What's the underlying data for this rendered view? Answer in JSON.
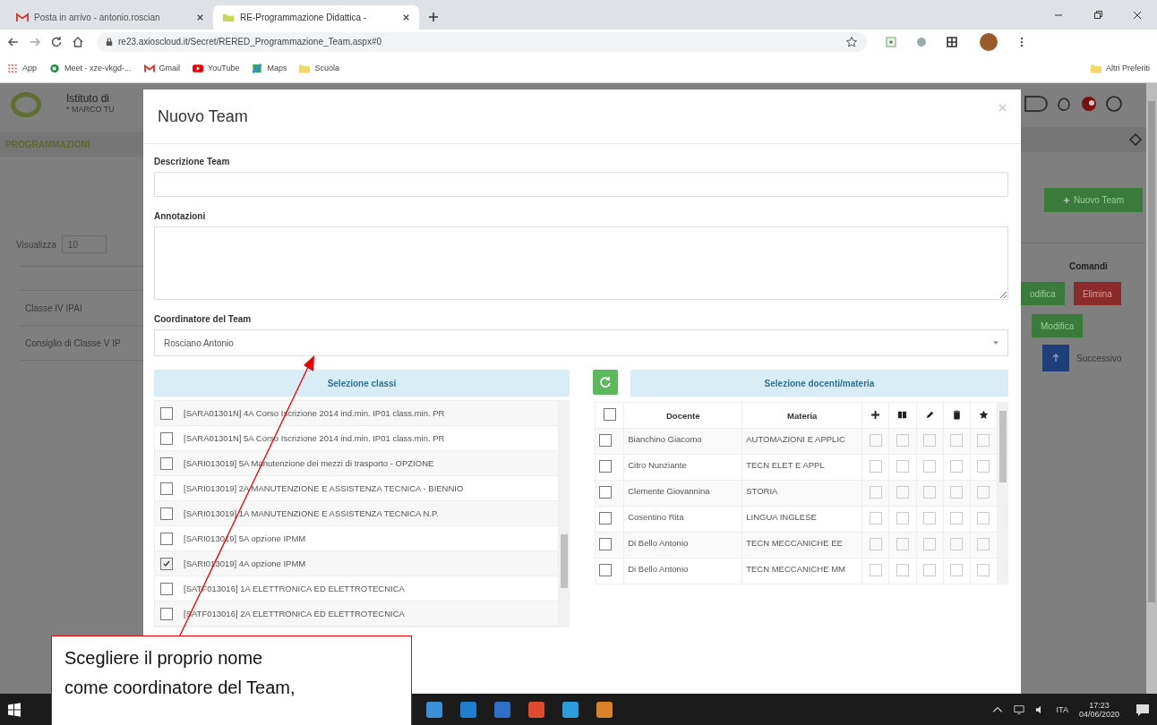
{
  "browser": {
    "tabs": [
      {
        "title": "Posta in arrivo - antonio.roscian",
        "selected": false
      },
      {
        "title": "RE-Programmazione Didattica -",
        "selected": true
      }
    ],
    "url": "re23.axioscloud.it/Secret/RERED_Programmazione_Team.aspx#0",
    "bookmarks": [
      {
        "label": "App",
        "kind": "apps"
      },
      {
        "label": "Meet - xze-vkgd-...",
        "kind": "meet"
      },
      {
        "label": "Gmail",
        "kind": "mail"
      },
      {
        "label": "YouTube",
        "kind": "video"
      },
      {
        "label": "Maps",
        "kind": "map"
      },
      {
        "label": "Scuola",
        "kind": "folder"
      }
    ],
    "other_bookmarks": "Altri Preferiti"
  },
  "background_page": {
    "school_name": "Istituto di",
    "school_subtitle": "* MARCO TU",
    "section": "PROGRAMMAZIONI",
    "show_label": "Visualizza",
    "page_size": "10",
    "rows": [
      "Classe IV IPAI",
      "Consiglio di Classe V IP"
    ],
    "new_team_button": "Nuovo Team",
    "commands_header": "Comandi",
    "row_actions": [
      [
        {
          "label": "odifica",
          "kind": "edit"
        },
        {
          "label": "Elimina",
          "kind": "delete"
        }
      ],
      [
        {
          "label": "Modifica",
          "kind": "edit"
        }
      ]
    ],
    "next_label": "Successivo"
  },
  "modal": {
    "title": "Nuovo Team",
    "description_label": "Descrizione Team",
    "notes_label": "Annotazioni",
    "coordinator_label": "Coordinatore del Team",
    "coordinator_value": "Rosciano Antonio",
    "classes_header": "Selezione classi",
    "classes": [
      {
        "label": "[SARA01301N] 4A Corso Iscrizione 2014 ind.min. IP01 class.min. PR",
        "checked": false
      },
      {
        "label": "[SARA01301N] 5A Corso Iscrizione 2014 ind.min. IP01 class.min. PR",
        "checked": false
      },
      {
        "label": "[SARI013019] 5A Manutenzione dei mezzi di trasporto - OPZIONE",
        "checked": false
      },
      {
        "label": "[SARI013019] 2A MANUTENZIONE E ASSISTENZA TECNICA - BIENNIO",
        "checked": false
      },
      {
        "label": "[SARI013019] 1A MANUTENZIONE E ASSISTENZA TECNICA N.P.",
        "checked": false
      },
      {
        "label": "[SARI013019] 5A opzione IPMM",
        "checked": false
      },
      {
        "label": "[SARI013019] 4A opzione IPMM",
        "checked": true
      },
      {
        "label": "[SATF013016] 1A ELETTRONICA ED ELETTROTECNICA",
        "checked": false
      },
      {
        "label": "[SATF013016] 2A ELETTRONICA ED ELETTROTECNICA",
        "checked": false
      }
    ],
    "teachers_header": "Selezione docenti/materia",
    "select_all_checked": false,
    "teacher_columns": [
      "Docente",
      "Materia"
    ],
    "teachers": [
      {
        "name": "Bianchino Giacomo",
        "subject": "AUTOMAZIONI E APPLIC",
        "checked": false,
        "permissions": [
          false,
          false,
          false,
          false,
          false
        ]
      },
      {
        "name": "Citro Nunziante",
        "subject": "TECN ELET E APPL",
        "checked": false,
        "permissions": [
          false,
          false,
          false,
          false,
          false
        ]
      },
      {
        "name": "Clemente Giovannina",
        "subject": "STORIA",
        "checked": false,
        "permissions": [
          false,
          false,
          false,
          false,
          false
        ]
      },
      {
        "name": "Cosentino Rita",
        "subject": "LINGUA INGLESE",
        "checked": false,
        "permissions": [
          false,
          false,
          false,
          false,
          false
        ]
      },
      {
        "name": "Di Bello Antonio",
        "subject": "TECN MECCANICHE EE",
        "checked": false,
        "permissions": [
          false,
          false,
          false,
          false,
          false
        ]
      },
      {
        "name": "Di Bello Antonio",
        "subject": "TECN MECCANICHE MM",
        "checked": false,
        "permissions": [
          false,
          false,
          false,
          false,
          false
        ]
      }
    ]
  },
  "callout": {
    "lines": [
      "Scegliere il proprio nome",
      "come coordinatore del Team,"
    ]
  },
  "taskbar": {
    "language": "ITA",
    "time": "17:23",
    "date": "04/06/2020"
  }
}
